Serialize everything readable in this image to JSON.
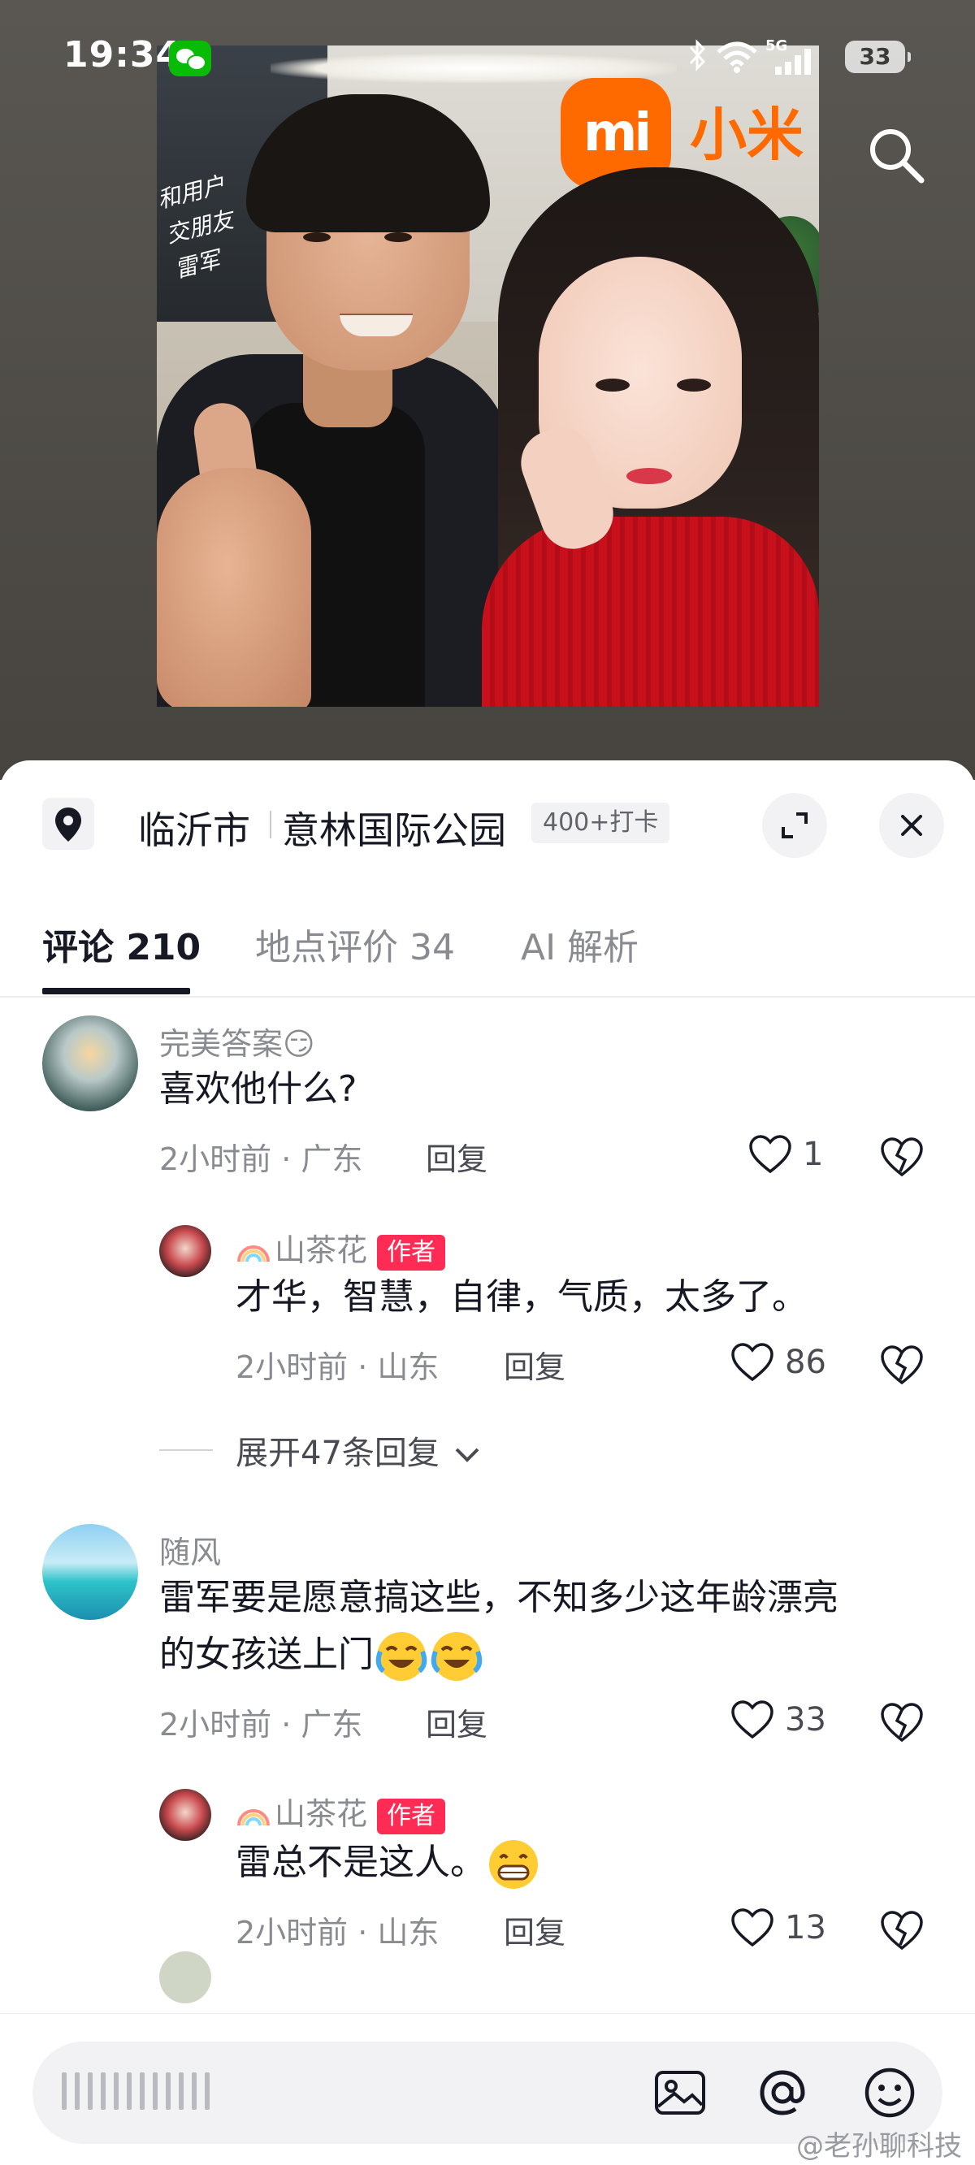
{
  "status_bar": {
    "time": "19:34",
    "network": "5G",
    "battery": "33"
  },
  "photo": {
    "brand_logo_text": "mi",
    "brand_name": "小米",
    "handwriting": [
      "和用户",
      "交朋友",
      "雷军"
    ]
  },
  "location": {
    "city": "临沂市",
    "place": "意林国际公园",
    "badge": "400+打卡"
  },
  "tabs": [
    {
      "label": "评论 210",
      "active": true
    },
    {
      "label": "地点评价 34",
      "active": false
    },
    {
      "label": "AI 解析",
      "active": false
    }
  ],
  "comments": [
    {
      "user": "完美答案😏",
      "text": "喜欢他什么?",
      "time_location": "2小时前 · 广东",
      "reply_label": "回复",
      "likes": "1",
      "replies": [
        {
          "user": "山茶花",
          "badge": "作者",
          "text": "才华，智慧，自律，气质，太多了。",
          "time_location": "2小时前 · 山东",
          "reply_label": "回复",
          "likes": "86"
        }
      ],
      "expand_label": "展开47条回复"
    },
    {
      "user": "随风",
      "text_line1": "雷军要是愿意搞这些，不知多少这年龄漂亮",
      "text_line2": "的女孩送上门",
      "time_location": "2小时前 · 广东",
      "reply_label": "回复",
      "likes": "33",
      "replies": [
        {
          "user": "山茶花",
          "badge": "作者",
          "text": "雷总不是这人。",
          "time_location": "2小时前 · 山东",
          "reply_label": "回复",
          "likes": "13"
        }
      ]
    }
  ],
  "watermark": "@老孙聊科技",
  "colors": {
    "accent": "#fe2c55",
    "brand": "#ff6a00",
    "text": "#161823",
    "muted": "#8a8b91"
  }
}
